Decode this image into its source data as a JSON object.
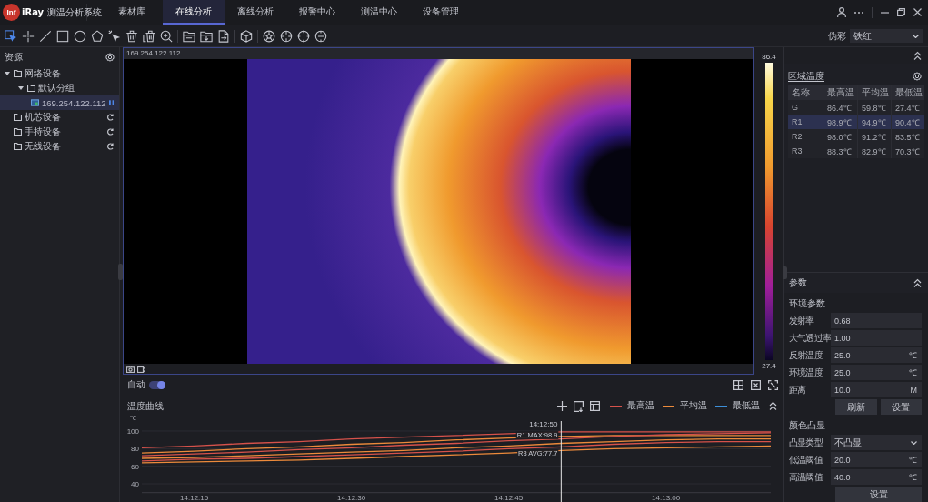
{
  "title_bar": {
    "logo": {
      "badge": "Inf",
      "text": "iRay"
    },
    "app_name": "测温分析系统",
    "tabs": [
      {
        "label": "素材库",
        "selected": false
      },
      {
        "label": "在线分析",
        "selected": true
      },
      {
        "label": "离线分析",
        "selected": false
      },
      {
        "label": "报警中心",
        "selected": false
      },
      {
        "label": "测温中心",
        "selected": false
      },
      {
        "label": "设备管理",
        "selected": false
      }
    ]
  },
  "toolbar": {
    "tool_groups": [
      [
        {
          "kind": "select",
          "selected": true
        },
        {
          "kind": "point",
          "selected": false
        },
        {
          "kind": "line",
          "selected": false
        },
        {
          "kind": "rectangle",
          "selected": false
        },
        {
          "kind": "circle",
          "selected": false
        },
        {
          "kind": "polygon",
          "selected": false
        },
        {
          "kind": "pick",
          "selected": false
        },
        {
          "kind": "delete",
          "selected": false
        },
        {
          "kind": "clear",
          "selected": false
        },
        {
          "kind": "zoom",
          "selected": false
        }
      ],
      [
        {
          "kind": "open"
        },
        {
          "kind": "save"
        },
        {
          "kind": "export"
        }
      ],
      [
        {
          "kind": "model"
        }
      ],
      [
        {
          "kind": "aperture"
        },
        {
          "kind": "target"
        },
        {
          "kind": "focus"
        },
        {
          "kind": "minus"
        }
      ]
    ],
    "palette": {
      "label": "伪彩",
      "value": "铁红"
    }
  },
  "resources": {
    "title": "资源",
    "tree": [
      {
        "label": "网络设备",
        "kind": "folder",
        "expanded": true,
        "selected": false,
        "children": [
          {
            "label": "默认分组",
            "kind": "folder",
            "expanded": true,
            "selected": false,
            "children": [
              {
                "label": "169.254.122.112",
                "kind": "device",
                "selected": true
              }
            ]
          }
        ]
      },
      {
        "label": "机芯设备",
        "kind": "source",
        "selected": false
      },
      {
        "label": "手持设备",
        "kind": "source",
        "selected": false
      },
      {
        "label": "无线设备",
        "kind": "source",
        "selected": false
      }
    ]
  },
  "video": {
    "title": "169.254.122.112",
    "scale": {
      "max": "86.4",
      "min": "27.4"
    }
  },
  "auto": {
    "label": "自动",
    "on": true
  },
  "curve": {
    "title": "温度曲线",
    "legend": [
      {
        "label": "最高温",
        "color": "#d6524b"
      },
      {
        "label": "平均温",
        "color": "#ec8a3b"
      },
      {
        "label": "最低温",
        "color": "#3d8fd8"
      }
    ],
    "chart_data": {
      "type": "line",
      "ylabel": "℃",
      "grid": true,
      "categories": [
        null,
        "14:12:15",
        null,
        null,
        "14:12:30",
        null,
        null,
        "14:12:45",
        null,
        null,
        "14:13:00",
        null,
        null
      ],
      "series": [
        {
          "color": "#d6524b",
          "values": [
            81,
            83,
            86,
            88,
            91,
            93,
            95,
            97,
            99,
            99,
            99,
            99,
            99
          ]
        },
        {
          "color": "#ec8a3b",
          "values": [
            75,
            77,
            80,
            82,
            85,
            87,
            90,
            92,
            94,
            95,
            95,
            95,
            95
          ]
        },
        {
          "color": "#d6524b",
          "values": [
            72,
            74,
            76,
            79,
            81,
            84,
            86,
            89,
            91,
            94,
            96,
            97,
            98
          ]
        },
        {
          "color": "#ec8a3b",
          "values": [
            69,
            70,
            72,
            74,
            76,
            78,
            81,
            83,
            86,
            88,
            90,
            91,
            91
          ]
        },
        {
          "color": "#d6524b",
          "values": [
            66,
            68,
            69,
            71,
            73,
            75,
            77,
            80,
            82,
            85,
            87,
            88,
            88
          ]
        },
        {
          "color": "#ec8a3b",
          "values": [
            64,
            65,
            66,
            67,
            69,
            71,
            73,
            75,
            78,
            80,
            81,
            82,
            83
          ]
        }
      ],
      "ylim": [
        30,
        110
      ],
      "yticks": [
        40,
        60,
        80,
        100
      ],
      "annotations": [
        "14:12:50",
        {
          "text": "R1 MAX:98.9",
          "y": 99
        },
        {
          "text": "R3 AVG:77.7",
          "y": 78
        }
      ]
    }
  },
  "region_temperature": {
    "title": "区域温度",
    "columns": [
      "名称",
      "最高温",
      "平均温",
      "最低温"
    ],
    "rows": [
      {
        "cells": [
          "G",
          "86.4℃",
          "59.8℃",
          "27.4℃"
        ],
        "selected": false
      },
      {
        "cells": [
          "R1",
          "98.9℃",
          "94.9℃",
          "90.4℃"
        ],
        "selected": true
      },
      {
        "cells": [
          "R2",
          "98.0℃",
          "91.2℃",
          "83.5℃"
        ],
        "selected": false
      },
      {
        "cells": [
          "R3",
          "88.3℃",
          "82.9℃",
          "70.3℃"
        ],
        "selected": false
      }
    ]
  },
  "parameters": {
    "title": "参数",
    "environment": {
      "title": "环境参数",
      "fields": [
        {
          "label": "发射率",
          "value": "0.68",
          "kind": "input"
        },
        {
          "label": "大气透过率",
          "value": "1.00",
          "kind": "input"
        },
        {
          "label": "反射温度",
          "value": "25.0",
          "unit": "℃",
          "kind": "input"
        },
        {
          "label": "环境温度",
          "value": "25.0",
          "unit": "℃",
          "kind": "input"
        },
        {
          "label": "距离",
          "value": "10.0",
          "unit": "M",
          "kind": "input"
        }
      ],
      "buttons": [
        "刷新",
        "设置"
      ]
    },
    "highlight": {
      "title": "颜色凸显",
      "fields": [
        {
          "label": "凸显类型",
          "value": "不凸显",
          "kind": "select"
        },
        {
          "label": "低温阈值",
          "value": "20.0",
          "unit": "℃",
          "kind": "input"
        },
        {
          "label": "高温阈值",
          "value": "40.0",
          "unit": "℃",
          "kind": "input"
        }
      ],
      "button": "设置"
    }
  }
}
